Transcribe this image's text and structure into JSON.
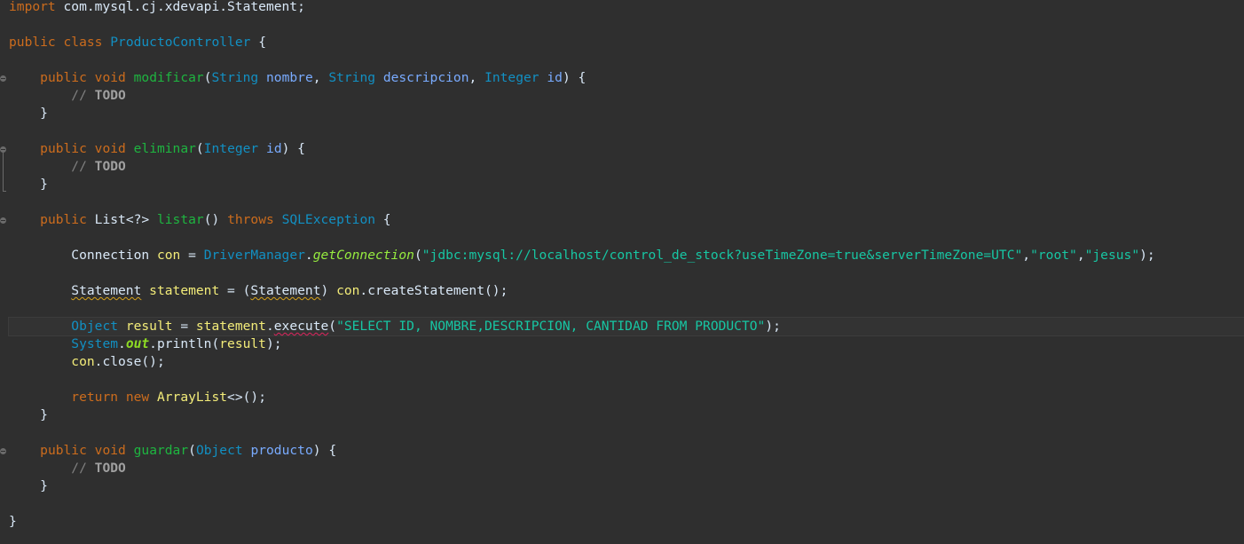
{
  "editor": {
    "theme_colors": {
      "background": "#2f2f2f",
      "keyword": "#cc6c1d",
      "class": "#1290c3",
      "method": "#1eb540",
      "variable": "#f3ec79",
      "parameter": "#79abff",
      "comment": "#808080",
      "string": "#17c6a3"
    },
    "lines": [
      {
        "tokens": [
          {
            "t": "import",
            "c": "kw"
          },
          {
            "t": " com.mysql.cj.xdevapi.Statement;",
            "c": "plain"
          }
        ]
      },
      {
        "tokens": [
          {
            "t": "public",
            "c": "kw"
          },
          {
            "t": " ",
            "c": "plain"
          },
          {
            "t": "class",
            "c": "kw"
          },
          {
            "t": " ",
            "c": "plain"
          },
          {
            "t": "ProductoController",
            "c": "cls"
          },
          {
            "t": " {",
            "c": "plain"
          }
        ]
      },
      {
        "tokens": [
          {
            "t": "    ",
            "c": "plain"
          },
          {
            "t": "public",
            "c": "kw"
          },
          {
            "t": " ",
            "c": "plain"
          },
          {
            "t": "void",
            "c": "kw"
          },
          {
            "t": " ",
            "c": "plain"
          },
          {
            "t": "modificar",
            "c": "mdef"
          },
          {
            "t": "(",
            "c": "plain"
          },
          {
            "t": "String",
            "c": "cls"
          },
          {
            "t": " ",
            "c": "plain"
          },
          {
            "t": "nombre",
            "c": "param"
          },
          {
            "t": ", ",
            "c": "plain"
          },
          {
            "t": "String",
            "c": "cls"
          },
          {
            "t": " ",
            "c": "plain"
          },
          {
            "t": "descripcion",
            "c": "param"
          },
          {
            "t": ", ",
            "c": "plain"
          },
          {
            "t": "Integer",
            "c": "cls"
          },
          {
            "t": " ",
            "c": "plain"
          },
          {
            "t": "id",
            "c": "param"
          },
          {
            "t": ") {",
            "c": "plain"
          }
        ]
      },
      {
        "tokens": [
          {
            "t": "        // ",
            "c": "cmt"
          },
          {
            "t": "TODO",
            "c": "todo"
          }
        ]
      },
      {
        "tokens": [
          {
            "t": "    }",
            "c": "plain"
          }
        ]
      },
      {
        "tokens": [
          {
            "t": "    ",
            "c": "plain"
          },
          {
            "t": "public",
            "c": "kw"
          },
          {
            "t": " ",
            "c": "plain"
          },
          {
            "t": "void",
            "c": "kw"
          },
          {
            "t": " ",
            "c": "plain"
          },
          {
            "t": "eliminar",
            "c": "mdef"
          },
          {
            "t": "(",
            "c": "plain"
          },
          {
            "t": "Integer",
            "c": "cls"
          },
          {
            "t": " ",
            "c": "plain"
          },
          {
            "t": "id",
            "c": "param"
          },
          {
            "t": ") {",
            "c": "plain"
          }
        ]
      },
      {
        "tokens": [
          {
            "t": "        // ",
            "c": "cmt"
          },
          {
            "t": "TODO",
            "c": "todo"
          }
        ]
      },
      {
        "tokens": [
          {
            "t": "    }",
            "c": "plain"
          }
        ]
      },
      {
        "tokens": [
          {
            "t": "    ",
            "c": "plain"
          },
          {
            "t": "public",
            "c": "kw"
          },
          {
            "t": " ",
            "c": "plain"
          },
          {
            "t": "List",
            "c": "iface"
          },
          {
            "t": "<?> ",
            "c": "plain"
          },
          {
            "t": "listar",
            "c": "mdef"
          },
          {
            "t": "() ",
            "c": "plain"
          },
          {
            "t": "throws",
            "c": "kw"
          },
          {
            "t": " ",
            "c": "plain"
          },
          {
            "t": "SQLException",
            "c": "cls"
          },
          {
            "t": " {",
            "c": "plain"
          }
        ]
      },
      {
        "tokens": [
          {
            "t": "        ",
            "c": "plain"
          },
          {
            "t": "Connection",
            "c": "iface"
          },
          {
            "t": " ",
            "c": "plain"
          },
          {
            "t": "con",
            "c": "var"
          },
          {
            "t": " = ",
            "c": "plain"
          },
          {
            "t": "DriverManager",
            "c": "cls"
          },
          {
            "t": ".",
            "c": "plain"
          },
          {
            "t": "getConnection",
            "c": "static-call"
          },
          {
            "t": "(",
            "c": "plain"
          },
          {
            "t": "\"jdbc:mysql://localhost/control_de_stock?useTimeZone=true&serverTimeZone=UTC\"",
            "c": "str"
          },
          {
            "t": ",",
            "c": "plain"
          },
          {
            "t": "\"root\"",
            "c": "str"
          },
          {
            "t": ",",
            "c": "plain"
          },
          {
            "t": "\"jesus\"",
            "c": "str"
          },
          {
            "t": ");",
            "c": "plain"
          }
        ]
      },
      {
        "tokens": [
          {
            "t": "        ",
            "c": "plain"
          },
          {
            "t": "Statement",
            "c": "iface warn"
          },
          {
            "t": " ",
            "c": "plain"
          },
          {
            "t": "statement",
            "c": "var"
          },
          {
            "t": " = (",
            "c": "plain"
          },
          {
            "t": "Statement",
            "c": "iface warn"
          },
          {
            "t": ") ",
            "c": "plain"
          },
          {
            "t": "con",
            "c": "var"
          },
          {
            "t": ".createStatement();",
            "c": "plain"
          }
        ]
      },
      {
        "tokens": [
          {
            "t": "        ",
            "c": "plain"
          },
          {
            "t": "Object",
            "c": "cls"
          },
          {
            "t": " ",
            "c": "plain"
          },
          {
            "t": "result",
            "c": "var"
          },
          {
            "t": " = ",
            "c": "plain"
          },
          {
            "t": "statement",
            "c": "var"
          },
          {
            "t": ".",
            "c": "plain"
          },
          {
            "t": "execute",
            "c": "plain err"
          },
          {
            "t": "(",
            "c": "plain"
          },
          {
            "t": "\"SELECT ID, NOMBRE,DESCRIPCION, CANTIDAD FROM PRODUCTO\"",
            "c": "str"
          },
          {
            "t": ");",
            "c": "plain"
          }
        ]
      },
      {
        "tokens": [
          {
            "t": "        ",
            "c": "plain"
          },
          {
            "t": "System",
            "c": "cls"
          },
          {
            "t": ".",
            "c": "plain"
          },
          {
            "t": "out",
            "c": "static-field"
          },
          {
            "t": ".println(",
            "c": "plain"
          },
          {
            "t": "result",
            "c": "var"
          },
          {
            "t": ");",
            "c": "plain"
          }
        ]
      },
      {
        "tokens": [
          {
            "t": "        ",
            "c": "plain"
          },
          {
            "t": "con",
            "c": "var"
          },
          {
            "t": ".close();",
            "c": "plain"
          }
        ]
      },
      {
        "tokens": [
          {
            "t": "        ",
            "c": "plain"
          },
          {
            "t": "return",
            "c": "kw"
          },
          {
            "t": " ",
            "c": "plain"
          },
          {
            "t": "new",
            "c": "kw"
          },
          {
            "t": " ",
            "c": "plain"
          },
          {
            "t": "ArrayList",
            "c": "var"
          },
          {
            "t": "<>();",
            "c": "plain"
          }
        ]
      },
      {
        "tokens": [
          {
            "t": "    }",
            "c": "plain"
          }
        ]
      },
      {
        "tokens": [
          {
            "t": "    ",
            "c": "plain"
          },
          {
            "t": "public",
            "c": "kw"
          },
          {
            "t": " ",
            "c": "plain"
          },
          {
            "t": "void",
            "c": "kw"
          },
          {
            "t": " ",
            "c": "plain"
          },
          {
            "t": "guardar",
            "c": "mdef"
          },
          {
            "t": "(",
            "c": "plain"
          },
          {
            "t": "Object",
            "c": "cls"
          },
          {
            "t": " ",
            "c": "plain"
          },
          {
            "t": "producto",
            "c": "param"
          },
          {
            "t": ") {",
            "c": "plain"
          }
        ]
      },
      {
        "tokens": [
          {
            "t": "        // ",
            "c": "cmt"
          },
          {
            "t": "TODO",
            "c": "todo"
          }
        ]
      },
      {
        "tokens": [
          {
            "t": "    }",
            "c": "plain"
          }
        ]
      },
      {
        "tokens": [
          {
            "t": "}",
            "c": "plain"
          }
        ]
      }
    ]
  }
}
